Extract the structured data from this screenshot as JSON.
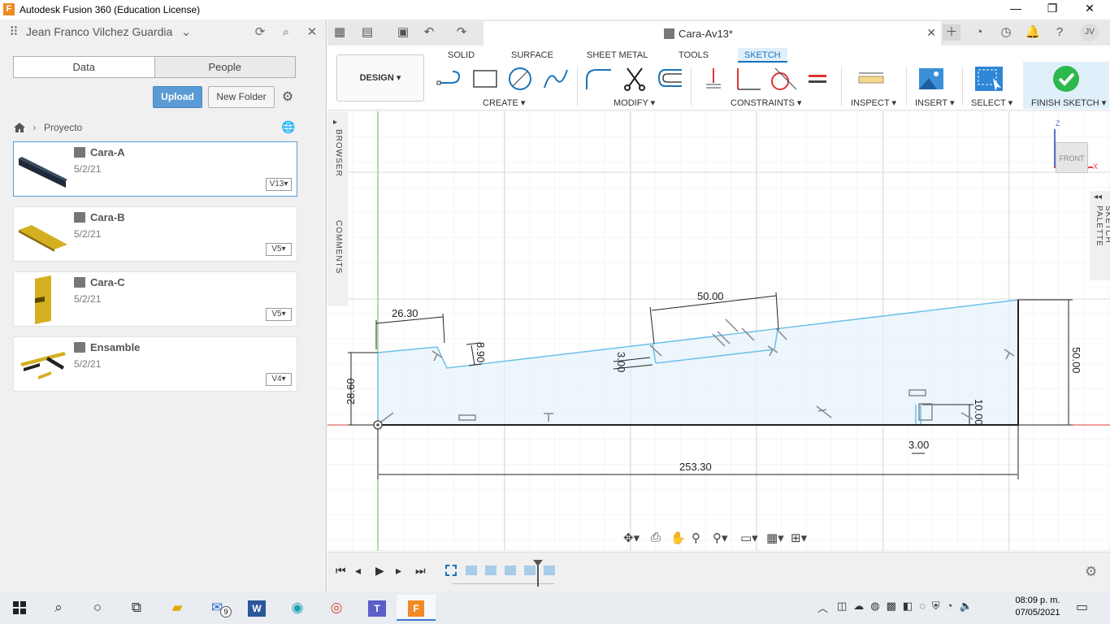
{
  "window": {
    "title": "Autodesk Fusion 360 (Education License)",
    "logo": "F",
    "minimize": "—",
    "maximize": "❐",
    "close": "✕"
  },
  "data_panel": {
    "user": "Jean Franco Vilchez Guardia",
    "tabs": [
      "Data",
      "People"
    ],
    "upload_label": "Upload",
    "new_folder_label": "New Folder",
    "breadcrumb": "Proyecto",
    "items": [
      {
        "name": "Cara-A",
        "date": "5/2/21",
        "version": "V13"
      },
      {
        "name": "Cara-B",
        "date": "5/2/21",
        "version": "V5"
      },
      {
        "name": "Cara-C",
        "date": "5/2/21",
        "version": "V5"
      },
      {
        "name": "Ensamble",
        "date": "5/2/21",
        "version": "V4"
      }
    ]
  },
  "document": {
    "tab_title": "Cara-Av13*",
    "user_initials": "JV"
  },
  "toolbar": {
    "design_label": "DESIGN",
    "workspaces": [
      "SOLID",
      "SURFACE",
      "SHEET METAL",
      "TOOLS",
      "SKETCH"
    ],
    "active_workspace": "SKETCH",
    "groups": {
      "create": "CREATE",
      "modify": "MODIFY",
      "constraints": "CONSTRAINTS",
      "inspect": "INSPECT",
      "insert": "INSERT",
      "select": "SELECT",
      "finish": "FINISH SKETCH"
    }
  },
  "side_labels": {
    "browser": "BROWSER",
    "comments": "COMMENTS",
    "sketch_palette": "SKETCH PALETTE"
  },
  "viewcube": {
    "face": "FRONT",
    "axis_z": "Z",
    "axis_x": "X"
  },
  "dimensions": {
    "d1": "26.30",
    "d2": "8.90",
    "d3": "28.60",
    "d4": "50.00",
    "d5": "3.00",
    "d6": "50.00",
    "d7": "10.00",
    "d8": "3.00",
    "d9": "253.30"
  },
  "taskbar": {
    "time": "08:09 p. m.",
    "date": "07/05/2021",
    "mail_badge": "9"
  },
  "colors": {
    "accent": "#1a73b8",
    "sketch_line": "#6cc0e8",
    "upload": "#5a9bd5",
    "finish_check": "#2db84d",
    "x_axis": "#e04040",
    "y_axis": "#55c255"
  }
}
